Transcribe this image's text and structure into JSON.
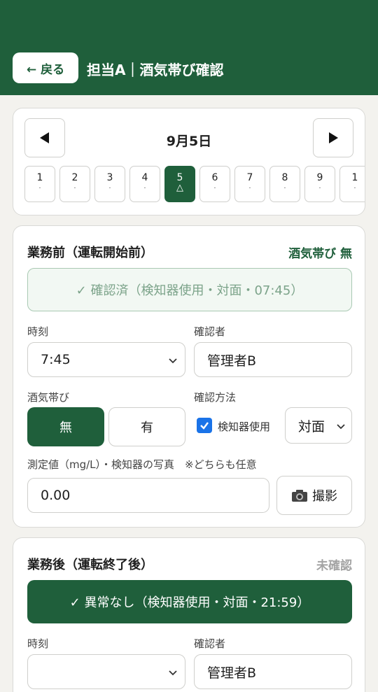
{
  "header": {
    "back_label": "← 戻る",
    "title": "担当A｜酒気帯び確認"
  },
  "date_nav": {
    "current": "9月5日",
    "days": [
      {
        "num": "1",
        "mark": "·"
      },
      {
        "num": "2",
        "mark": "·"
      },
      {
        "num": "3",
        "mark": "·"
      },
      {
        "num": "4",
        "mark": "·"
      },
      {
        "num": "5",
        "mark": "△"
      },
      {
        "num": "6",
        "mark": "·"
      },
      {
        "num": "7",
        "mark": "·"
      },
      {
        "num": "8",
        "mark": "·"
      },
      {
        "num": "9",
        "mark": "·"
      },
      {
        "num": "1",
        "mark": "·"
      }
    ]
  },
  "before": {
    "title": "業務前（運転開始前）",
    "status": "酒気帯び 無",
    "banner": "✓ 確認済（検知器使用・対面・07:45）",
    "time_label": "時刻",
    "time_value": "7:45",
    "checker_label": "確認者",
    "checker_value": "管理者B",
    "alcohol_label": "酒気帯び",
    "alcohol_no": "無",
    "alcohol_yes": "有",
    "method_label": "確認方法",
    "detector_label": "検知器使用",
    "method_value": "対面",
    "measure_label": "測定値（mg/L）・検知器の写真　※どちらも任意",
    "measure_value": "0.00",
    "photo_label": "撮影"
  },
  "after": {
    "title": "業務後（運転終了後）",
    "status": "未確認",
    "banner": "✓ 異常なし（検知器使用・対面・21:59）",
    "time_label": "時刻",
    "time_value": "",
    "checker_label": "確認者",
    "checker_value": "管理者B"
  },
  "colors": {
    "brand": "#1f5f3b",
    "checkbox": "#1a73e8",
    "muted": "#9a9a9a"
  }
}
